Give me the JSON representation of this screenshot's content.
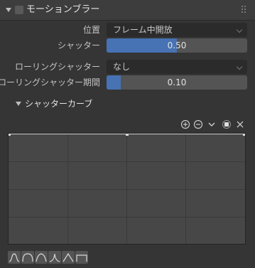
{
  "panel": {
    "title": "モーションブラー",
    "enabled": false
  },
  "position": {
    "label": "位置",
    "value": "フレーム中開放"
  },
  "shutter": {
    "label": "シャッター",
    "value": "0.50",
    "fraction": 0.5
  },
  "rolling_shutter": {
    "label": "ローリングシャッター",
    "value": "なし"
  },
  "rolling_duration": {
    "label": "ローリングシャッター期間",
    "value": "0.10",
    "fraction": 0.1
  },
  "shutter_curve": {
    "label": "シャッターカーブ"
  },
  "curve_toolbar": {
    "icons": [
      "zoom-in-icon",
      "zoom-out-icon",
      "chevron-down-icon",
      "clipping-icon",
      "close-icon"
    ]
  },
  "curve_presets": [
    "smooth",
    "sphere",
    "root",
    "sharp",
    "linear",
    "max"
  ],
  "colors": {
    "accent": "#4772b3",
    "panel_bg": "#353535",
    "field_bg": "#2b2b2b",
    "slider_bg": "#545454"
  }
}
